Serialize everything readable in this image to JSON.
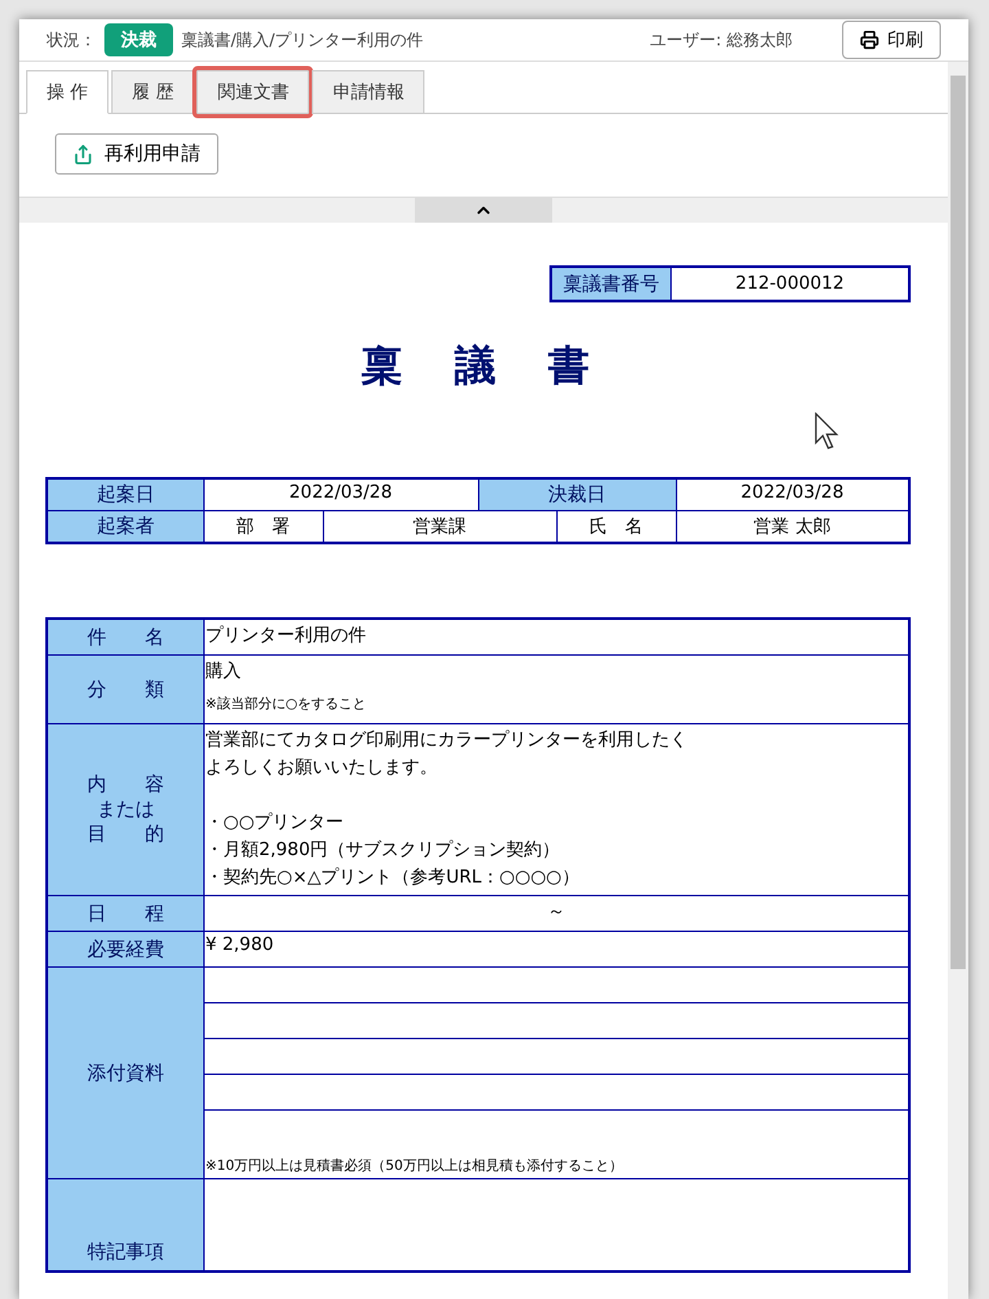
{
  "header": {
    "status_label": "状況：",
    "status": "決裁",
    "breadcrumb": "稟議書/購入/プリンター利用の件",
    "user": "ユーザー: 総務太郎",
    "print_button": "印刷"
  },
  "tabs": [
    {
      "label": "操 作",
      "selected": true,
      "highlighted": false
    },
    {
      "label": "履 歴",
      "selected": false,
      "highlighted": false
    },
    {
      "label": "関連文書",
      "selected": false,
      "highlighted": true
    },
    {
      "label": "申請情報",
      "selected": false,
      "highlighted": false
    }
  ],
  "action_button": "再利用申請",
  "document": {
    "number_label": "稟議書番号",
    "number": "212-000012",
    "title": "稟　議　書",
    "dates": {
      "drafted_label": "起案日",
      "drafted": "2022/03/28",
      "approved_label": "決裁日",
      "approved": "2022/03/28"
    },
    "drafter": {
      "label": "起案者",
      "dept_label": "部　署",
      "dept": "営業課",
      "name_label": "氏　名",
      "name": "営業 太郎"
    },
    "rows": [
      {
        "kind": "text",
        "label": [
          "件　　名"
        ],
        "value": "プリンター利用の件"
      },
      {
        "kind": "category",
        "label": [
          "分　　類"
        ],
        "value": "購入",
        "note": "※該当部分に○をすること"
      },
      {
        "kind": "paragraphs",
        "label": [
          "内　　容",
          "または",
          "目　　的"
        ],
        "paragraphs": [
          [
            "営業部にてカタログ印刷用にカラープリンターを利用したく",
            "よろしくお願いいたします。"
          ],
          [
            "・○○プリンター",
            "・月額2,980円（サブスクリプション契約）",
            "・契約先○×△プリント（参考URL：○○○○）"
          ]
        ]
      },
      {
        "kind": "center",
        "label": [
          "日　　程"
        ],
        "value": "～"
      },
      {
        "kind": "text",
        "label": [
          "必要経費"
        ],
        "value": "¥ 2,980"
      },
      {
        "kind": "attachments",
        "label": [
          "添付資料"
        ],
        "note": "※10万円以上は見積書必須（50万円以上は相見積も添付すること）"
      },
      {
        "kind": "blank",
        "label": [
          "特記事項"
        ]
      }
    ]
  }
}
